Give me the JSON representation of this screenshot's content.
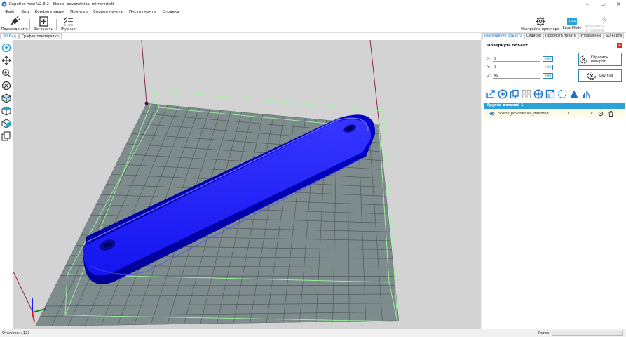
{
  "window": {
    "title": "Repetier-Host V2.3.2 - Steklo_povorotnika_mirrored.stl",
    "minimize": "–",
    "maximize": "▭",
    "close": "✕"
  },
  "menu": [
    "Файл",
    "Вид",
    "Конфигурация",
    "Принтер",
    "Сервер печати",
    "Инструменты",
    "Справка"
  ],
  "toolbar": {
    "connect": "Подсоединить",
    "load": "Загрузить",
    "log": "Журнал",
    "printer_settings": "Настройка принтера",
    "easy_mode": "Easy Mode",
    "easy_badge": "EASY",
    "emergency": "Аварийная остановка"
  },
  "left_tabs": [
    "3D-Вид",
    "График температур"
  ],
  "right_tabs": [
    "Размещение объекта",
    "Слайсер",
    "Просмотр печати",
    "Управление",
    "SD-карта"
  ],
  "rotate": {
    "title": "Повернуть объект",
    "axes": [
      {
        "label": "X:",
        "value": "0",
        "btn": "+90"
      },
      {
        "label": "Y:",
        "value": "0",
        "btn": "+90"
      },
      {
        "label": "Z:",
        "value": "45",
        "btn": "+90"
      }
    ],
    "reset_label": "Сбросить поворот",
    "layflat_label": "Lay Flat",
    "close": "✕"
  },
  "group": {
    "title": "Группа деталей 1",
    "object_name": "Steklo_povorotnika_mirrored",
    "count": "1",
    "dropdown": "▾"
  },
  "status": {
    "connection": "Отключен: 123",
    "middle": "-",
    "ready": "Готов"
  },
  "colors": {
    "accent": "#29a3d8",
    "model": "#1a1aff",
    "bed": "#7f8c8d"
  }
}
